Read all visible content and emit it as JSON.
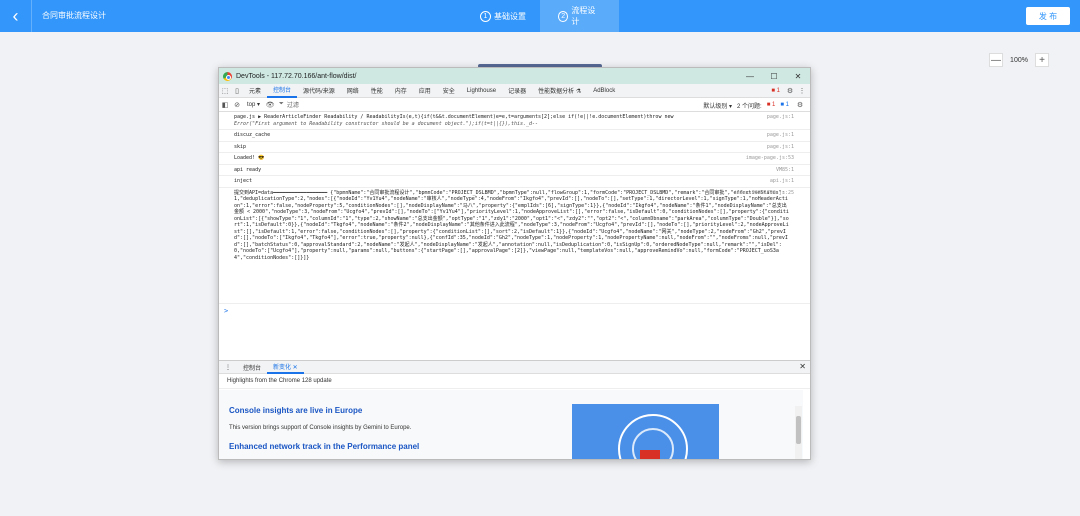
{
  "header": {
    "back_icon": "chevron-left-icon",
    "title": "合同审批流程设计",
    "steps": [
      {
        "num": "1",
        "label": "基础设置"
      },
      {
        "num": "2",
        "label": "流程设计"
      }
    ],
    "publish_label": "发 布",
    "accent": "#3296fa"
  },
  "zoom": {
    "minus": "—",
    "value": "100%",
    "plus": "+"
  },
  "devtools": {
    "window_title": "DevTools - 117.72.70.166/ant-flow/dist/",
    "window_buttons": {
      "min": "—",
      "max": "☐",
      "close": "✕"
    },
    "tabs": [
      "元素",
      "控制台",
      "源代码/来源",
      "网络",
      "性能",
      "内存",
      "应用",
      "安全",
      "Lighthouse",
      "记录器",
      "性能数据分析 ⚗",
      "AdBlock"
    ],
    "tabs_right": {
      "errors": "■ 1",
      "more": "⋮"
    },
    "toolbar": {
      "context": "top ▾",
      "filter_placeholder": "过滤",
      "level": "默认级别 ▾",
      "issues_label": "2 个问题:",
      "issues_a": "■ 1",
      "issues_b": "■ 1"
    },
    "console": [
      {
        "msg": "page.js ▶ ReaderArticleFinder Readability / ReadabilityIs(e,t){if(t&&t.documentElement)e=e,t=arguments[2];else if(!e||!e.documentElement)throw new",
        "msg2": "Error(\"First argument to Readability constructor should be a document object.\");if(t=t||{}),this._d--",
        "src": "page.js:1"
      },
      {
        "msg": "discuz_cache",
        "src": "page.js:1"
      },
      {
        "msg": "skip",
        "src": "page.js:1"
      },
      {
        "msg": "Loaded! 😎",
        "src": "image-page.js:53"
      },
      {
        "msg": "api ready",
        "src": "VM85:1"
      },
      {
        "msg": "inject",
        "src": "api.js:1"
      },
      {
        "msg": "提交到API=data━━━━━━━━━━━━━━━━━━ {\"bpmnName\":\"合同审批流程设计\",\"bpmnCode\":\"PROJECT_DSLBMD\",\"bpmnType\":null,\"flowGroup\":1,\"formCode\":\"PROJECT_DSLBMD\",\"remark\":\"合同审批\",\"effectiveStatus\":1,\"deduplicationType\":2,\"nodes\":[{\"nodeId\":\"Yv1Yu4\",\"nodeName\":\"审核人\",\"nodeType\":4,\"nodeFrom\":\"Ikgfo4\",\"prevId\":[],\"nodeTo\":[],\"setType\":1,\"directorLevel\":1,\"signType\":1,\"noHeaderAction\":1,\"error\":false,\"nodeProperty\":5,\"conditionNodes\":[],\"nodeDisplayName\":\"马八\",\"property\":{\"emplIds\":[6],\"signType\":1}},{\"nodeId\":\"Ikgfo4\",\"nodeName\":\"条件1\",\"nodeDisplayName\":\"总支出金额 < 2000\",\"nodeType\":3,\"nodeFrom\":\"Ucgfo4\",\"prevId\":[],\"nodeTo\":[\"Yv1Yu4\"],\"priorityLevel\":1,\"nodeApproveList\":[],\"error\":false,\"isDefault\":0,\"conditionNodes\":[],\"property\":{\"conditionList\":[{\"showType\":\"1\",\"columnId\":\"1\",\"type\":2,\"showName\":\"总支出金额\",\"optType\":\"1\",\"zdy1\":\"2000\",\"opt1\":\"<\",\"zdy2\":\"\",\"opt2\":\"<\",\"columnDbname\":\"parkArea\",\"columnType\":\"Double\"}],\"sort\":1,\"isDefault\":0}},{\"nodeId\":\"Tkgfo4\",\"nodeName\":\"条件2\",\"nodeDisplayName\":\"其他条件进入此流程\",\"nodeType\":3,\"nodeFrom\":\"Ucgfo4\",\"prevId\":[],\"nodeTo\":[],\"priorityLevel\":2,\"nodeApproveList\":[],\"isDefault\":1,\"error\":false,\"conditionNodes\":[],\"property\":{\"conditionList\":[],\"sort\":2,\"isDefault\":1}},{\"nodeId\":\"Ucgfo4\",\"nodeName\":\"网关\",\"nodeType\":2,\"nodeFrom\":\"Gh2\",\"prevId\":[],\"nodeTo\":[\"Ikgfo4\",\"Tkgfo4\"],\"error\":true,\"property\":null},{\"confId\":35,\"nodeId\":\"Gh2\",\"nodeType\":1,\"nodeProperty\":1,\"nodePropertyName\":null,\"nodeFrom\":\"\",\"nodeFroms\":null,\"prevId\":[],\"batchStatus\":0,\"approvalStandard\":2,\"nodeName\":\"发起人\",\"nodeDisplayName\":\"发起人\",\"annotation\":null,\"isDeduplication\":0,\"isSignUp\":0,\"orderedNodeType\":null,\"remark\":\"\",\"isDel\":0,\"nodeTo\":[\"Ucgfo4\"],\"property\":null,\"params\":null,\"buttons\":{\"startPage\":[],\"approvalPage\":[2]},\"viewPage\":null,\"templateVos\":null,\"approveRemindVo\":null,\"formCode\":\"PROJECT_uoS3a4\",\"conditionNodes\":[]}]}",
        "src": "index-96881796.js:25"
      }
    ],
    "prompt": ">",
    "drawer": {
      "tabs": [
        "控制台",
        "新变化 ✕"
      ],
      "more_icon": "⋮",
      "close": "✕"
    },
    "whatsnew": {
      "highlights": "Highlights from the Chrome 128 update",
      "h1": "Console insights are live in Europe",
      "p1": "This version brings support of Console insights by Gemini to Europe.",
      "h2": "Enhanced network track in the Performance panel"
    }
  }
}
